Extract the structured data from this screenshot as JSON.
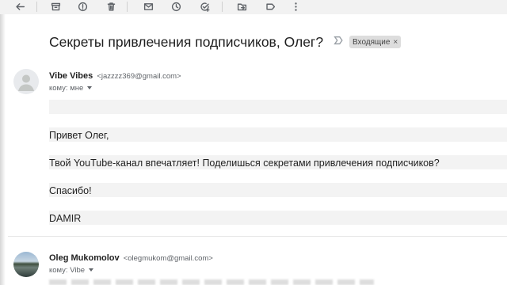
{
  "toolbar": {
    "icons": [
      "back-arrow-icon",
      "archive-icon",
      "report-spam-icon",
      "delete-icon",
      "mark-unread-icon",
      "snooze-icon",
      "add-task-icon",
      "move-to-icon",
      "label-icon",
      "more-icon"
    ]
  },
  "thread": {
    "subject": "Секреты привлечения подписчиков, Олег?",
    "label_chip": "Входящие",
    "label_chip_close": "×"
  },
  "message1": {
    "sender_name": "Vibe Vibes",
    "sender_email": "<jazzzz369@gmail.com>",
    "recipient": "кому: мне",
    "body": [
      "Привет Олег,",
      "Твой YouTube-канал впечатляет! Поделишься секретами привлечения подписчиков?",
      "Спасибо!",
      "DAMIR"
    ]
  },
  "message2": {
    "sender_name": "Oleg Mukomolov",
    "sender_email": "<olegmukom@gmail.com>",
    "recipient": "кому: Vibe"
  }
}
